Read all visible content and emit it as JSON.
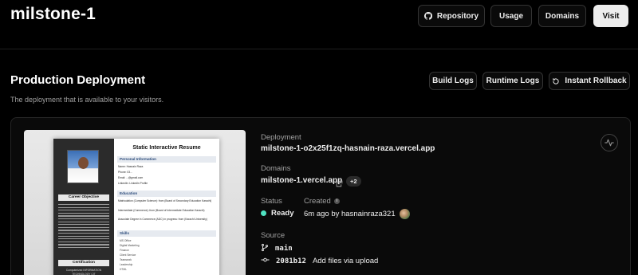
{
  "project": {
    "name": "milstone-1"
  },
  "header": {
    "repository_label": "Repository",
    "usage_label": "Usage",
    "domains_label": "Domains",
    "visit_label": "Visit"
  },
  "production": {
    "title": "Production Deployment",
    "subtitle": "The deployment that is available to your visitors.",
    "build_logs_label": "Build Logs",
    "runtime_logs_label": "Runtime Logs",
    "instant_rollback_label": "Instant Rollback"
  },
  "deployment": {
    "deployment_label": "Deployment",
    "deployment_url": "milstone-1-o2x25f1zq-hasnain-raza.vercel.app",
    "domains_label": "Domains",
    "domain": "milstone-1.vercel.app",
    "extra_domains": "+2",
    "status_label": "Status",
    "status_value": "Ready",
    "status_color": "#50e3c2",
    "created_label": "Created",
    "created_value": "6m ago by hasnainraza321",
    "source_label": "Source",
    "branch": "main",
    "commit_hash": "2081b12",
    "commit_message": "Add files via upload"
  },
  "preview": {
    "title": "Static Interactive Resume",
    "personal_heading": "Personal Information",
    "name_line": "Name: Hasnain Raza",
    "phone_line": "Phone: 03...",
    "email_line": "Email: ...@gmail.com",
    "linkedin_line": "LinkedIn: LinkedIn Profile",
    "education_heading": "Education",
    "edu_1": "Matriculation (Computer Science): from (Board of Secondary Education Karachi)",
    "edu_2": "Intermediate (Commerce): from (Board of Intermediate Education Karachi)",
    "edu_3": "Associate Degree in Commerce (ADC) in progress: from (Karachi University)",
    "skills_heading": "Skills",
    "skills": [
      "MS Office",
      "Digital Marketing",
      "Finance",
      "Client Service",
      "Teamwork",
      "Leadership",
      "HTML"
    ],
    "career_heading": "Career Objective",
    "cert_heading": "Certification",
    "cert_text": "Computerized INFORMATION TECHNOLOGY CIT"
  },
  "icons": {
    "github": "github-icon",
    "rollback": "rollback-icon",
    "external": "external-link-icon",
    "info": "info-icon",
    "branch": "git-branch-icon",
    "commit": "git-commit-icon",
    "activity": "activity-icon"
  }
}
